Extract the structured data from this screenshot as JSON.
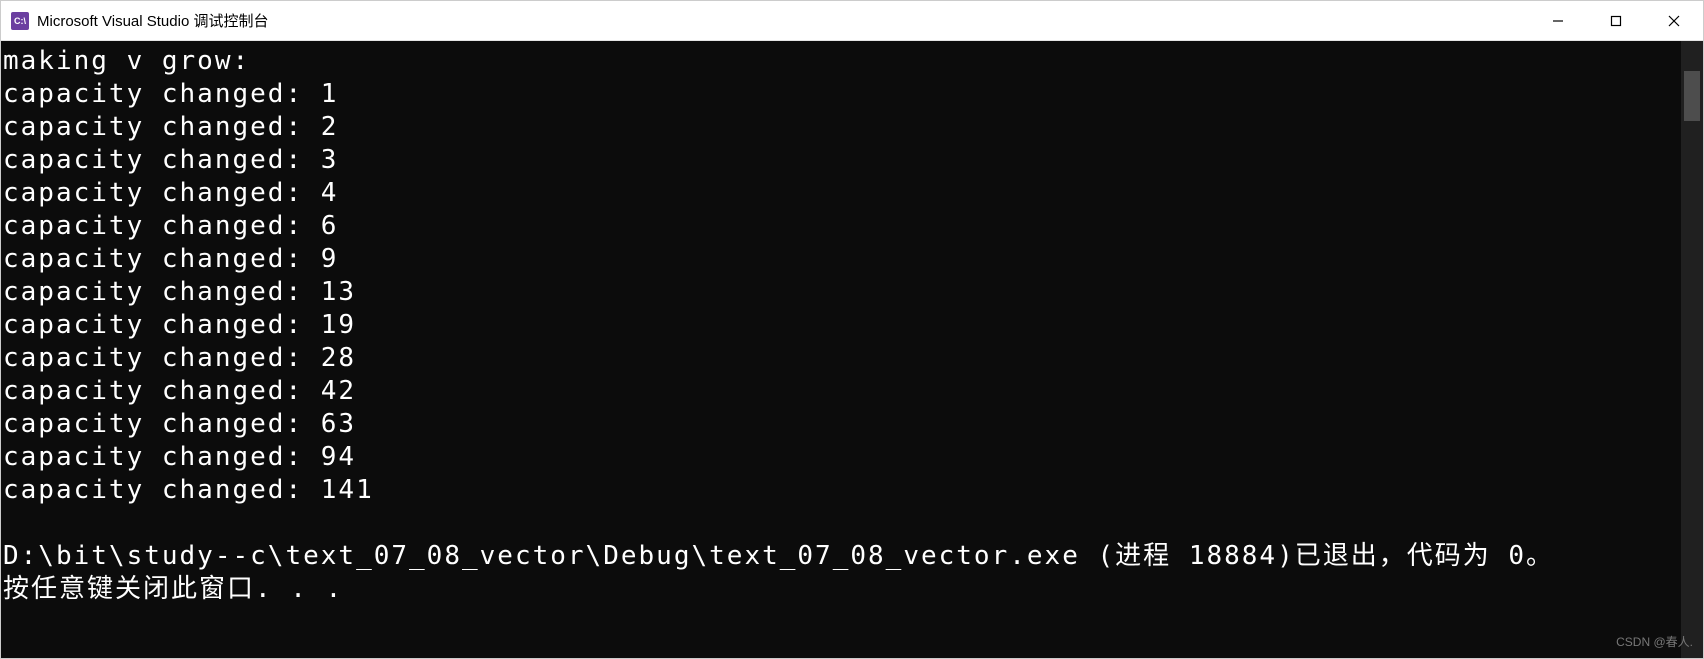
{
  "window": {
    "app_icon_text": "C:\\",
    "title": "Microsoft Visual Studio 调试控制台"
  },
  "console": {
    "header_line": "making v grow:",
    "capacity_label": "capacity changed: ",
    "capacities": [
      1,
      2,
      3,
      4,
      6,
      9,
      13,
      19,
      28,
      42,
      63,
      94,
      141
    ],
    "exit_line": "D:\\bit\\study--c\\text_07_08_vector\\Debug\\text_07_08_vector.exe (进程 18884)已退出，代码为 0。",
    "prompt_line": "按任意键关闭此窗口. . ."
  },
  "watermark": "CSDN @春人."
}
